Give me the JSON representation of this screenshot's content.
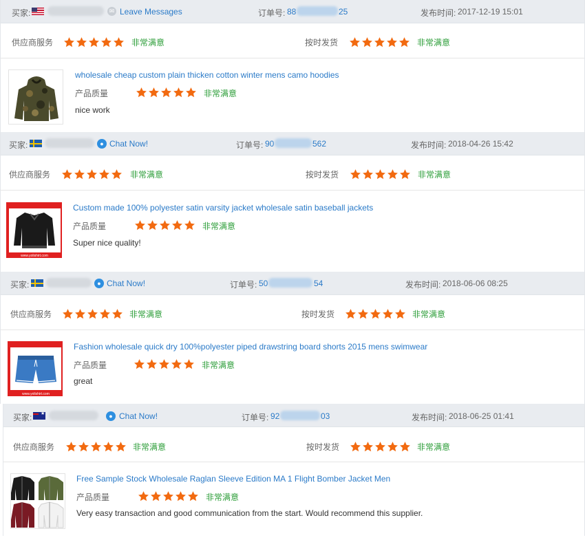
{
  "labels": {
    "buyer": "买家:",
    "order": "订单号:",
    "published": "发布时间:",
    "supplier_service": "供应商服务",
    "on_time_delivery": "按时发货",
    "product_quality": "产品质量",
    "very_satisfied": "非常满意"
  },
  "colors": {
    "star": "#f26a10",
    "link": "#2a7ac8",
    "rating_text": "#2e9e3a",
    "header_bg": "#e9ecf0"
  },
  "reviews": [
    {
      "country_flag": "us-flag-icon",
      "contact_label": "Leave Messages",
      "order_prefix": "88",
      "order_suffix": "25",
      "date": "2017-12-19 15:01",
      "supplier_stars": 5,
      "delivery_stars": 5,
      "quality_stars": 5,
      "product_title": "wholesale cheap custom plain thicken cotton winter mens camo hoodies",
      "comment": "nice work"
    },
    {
      "country_flag": "sweden-flag-icon",
      "contact_label": "Chat Now!",
      "order_prefix": "90",
      "order_suffix": "562",
      "date": "2018-04-26 15:42",
      "supplier_stars": 5,
      "delivery_stars": 5,
      "quality_stars": 5,
      "product_title": "Custom made 100% polyester satin varsity jacket wholesale satin baseball jackets",
      "comment": "Super nice quality!"
    },
    {
      "country_flag": "sweden-flag-icon",
      "contact_label": "Chat Now!",
      "order_prefix": "50",
      "order_suffix": "54",
      "date": "2018-06-06 08:25",
      "supplier_stars": 5,
      "delivery_stars": 5,
      "quality_stars": 5,
      "product_title": "Fashion wholesale quick dry 100%polyester piped drawstring board shorts 2015 mens swimwear",
      "comment": "great"
    },
    {
      "country_flag": "australia-flag-icon",
      "contact_label": "Chat Now!",
      "order_prefix": "92",
      "order_suffix": "03",
      "date": "2018-06-25 01:41",
      "supplier_stars": 5,
      "delivery_stars": 5,
      "quality_stars": 5,
      "product_title": "Free Sample Stock Wholesale Raglan Sleeve Edition MA 1 Flight Bomber Jacket Men",
      "comment": "Very easy transaction and good communication from the start. Would recommend this supplier."
    }
  ]
}
